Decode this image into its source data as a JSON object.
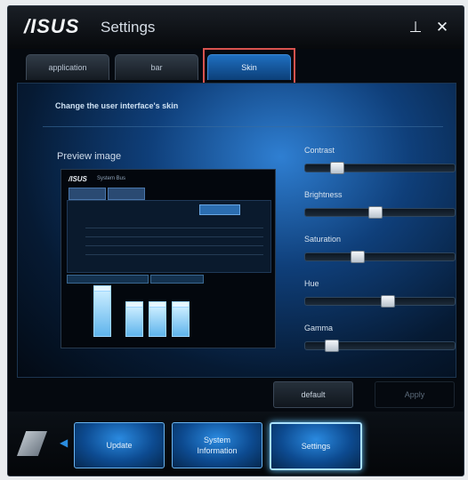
{
  "window": {
    "logo_text": "/ISUS",
    "title": "Settings",
    "pin_icon": "pin-icon",
    "close_icon": "close-icon"
  },
  "tabs": [
    {
      "label": "application",
      "active": false
    },
    {
      "label": "bar",
      "active": false
    },
    {
      "label": "Skin",
      "active": true
    }
  ],
  "skin": {
    "description": "Change the user interface's skin",
    "preview_label": "Preview image",
    "preview_mini": {
      "logo": "/ISUS",
      "title": "System Bus"
    },
    "sliders": [
      {
        "label": "Contrast",
        "value": 0.18
      },
      {
        "label": "Brightness",
        "value": 0.46
      },
      {
        "label": "Saturation",
        "value": 0.33
      },
      {
        "label": "Hue",
        "value": 0.55
      },
      {
        "label": "Gamma",
        "value": 0.14
      }
    ]
  },
  "actions": {
    "default_label": "default",
    "apply_label": "Apply"
  },
  "bottom_nav": [
    {
      "label": "Update",
      "active": false
    },
    {
      "label": "System\nInformation",
      "active": false
    },
    {
      "label": "Settings",
      "active": true
    }
  ],
  "colors": {
    "accent": "#2b8de0",
    "highlight_box": "#d9534f",
    "active_border": "#a9e0ff"
  }
}
